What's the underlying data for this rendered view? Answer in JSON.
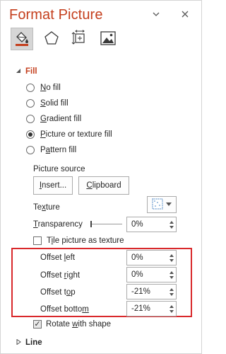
{
  "pane": {
    "title": "Format Picture",
    "dropdown_icon": "chevron-down-icon",
    "close_icon": "close-icon"
  },
  "tabs": [
    {
      "name": "fill-line-icon",
      "active": true
    },
    {
      "name": "effects-pentagon-icon",
      "active": false
    },
    {
      "name": "size-properties-icon",
      "active": false
    },
    {
      "name": "picture-icon",
      "active": false
    }
  ],
  "fill": {
    "header": "Fill",
    "options": [
      {
        "u": "N",
        "rest": "o fill",
        "checked": false
      },
      {
        "u": "S",
        "rest": "olid fill",
        "checked": false
      },
      {
        "u": "G",
        "rest": "radient fill",
        "checked": false
      },
      {
        "u": "P",
        "rest": "icture or texture fill",
        "checked": true
      },
      {
        "u": "P",
        "rest": "a",
        "rest2": "ttern fill",
        "checked": false
      }
    ],
    "picture_source_label": "Picture source",
    "insert_u": "I",
    "insert_rest": "nsert...",
    "clipboard_u": "C",
    "clipboard_rest": "lipboard",
    "texture_label_a": "Te",
    "texture_label_u": "x",
    "texture_label_b": "ture",
    "transparency_u": "T",
    "transparency_rest": "ransparency",
    "transparency_value": "0%",
    "tile_u": "i",
    "tile_a": "T",
    "tile_rest": "le picture as texture",
    "offset_left_a": "Offset ",
    "offset_left_u": "l",
    "offset_left_b": "eft",
    "offset_left_value": "0%",
    "offset_right_a": "Offset ",
    "offset_right_u": "r",
    "offset_right_b": "ight",
    "offset_right_value": "0%",
    "offset_top_a": "Offset t",
    "offset_top_u": "o",
    "offset_top_b": "p",
    "offset_top_value": "-21%",
    "offset_bottom_a": "Offset botto",
    "offset_bottom_u": "m",
    "offset_bottom_b": "",
    "offset_bottom_value": "-21%",
    "rotate_a": "Rotate ",
    "rotate_u": "w",
    "rotate_b": "ith shape",
    "rotate_checked": true
  },
  "line": {
    "header": "Line"
  },
  "colors": {
    "accent": "#c43e1c",
    "highlight_box": "#d9282b"
  }
}
